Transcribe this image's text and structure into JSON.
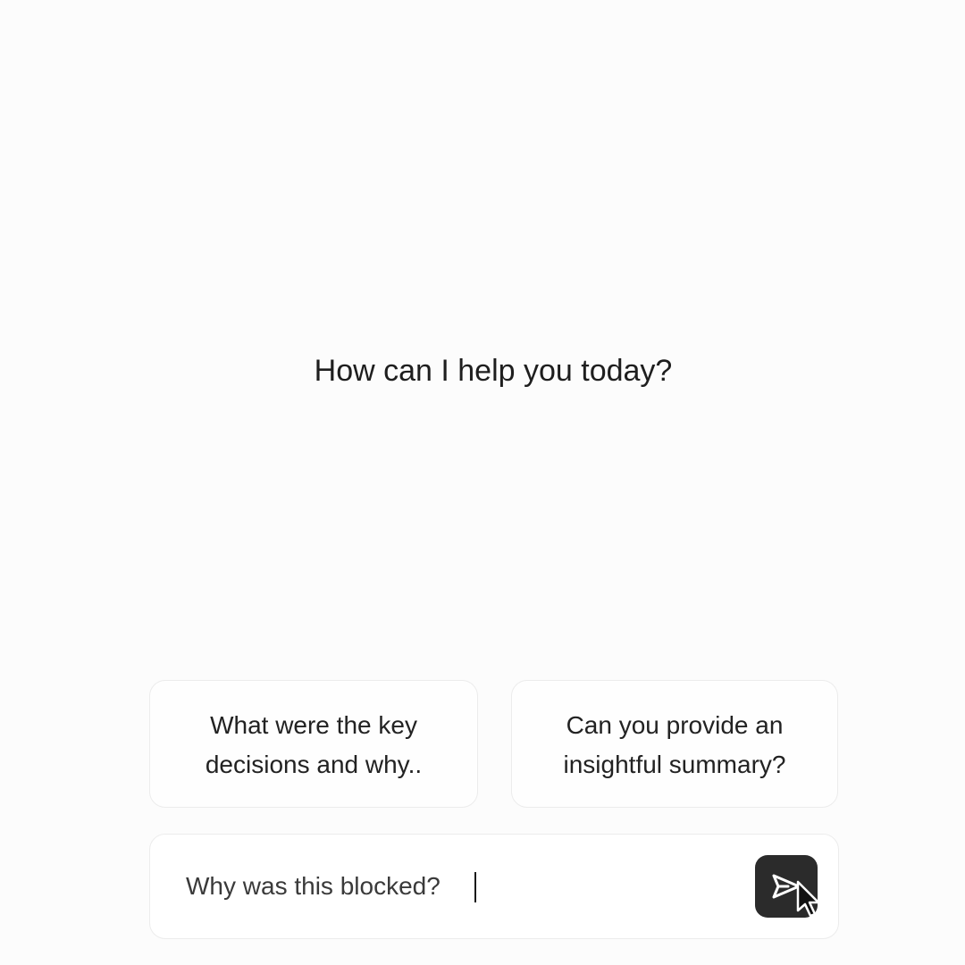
{
  "greeting": "How can I help you today?",
  "suggestions": [
    {
      "label": "What were the key\ndecisions and why.."
    },
    {
      "label": "Can you provide an\ninsightful summary?"
    }
  ],
  "composer": {
    "value": "Why was this blocked?",
    "send_icon": "send-icon"
  },
  "colors": {
    "background": "#fcfcfc",
    "send_button": "#2b2b2b",
    "card_border": "#ececec"
  }
}
